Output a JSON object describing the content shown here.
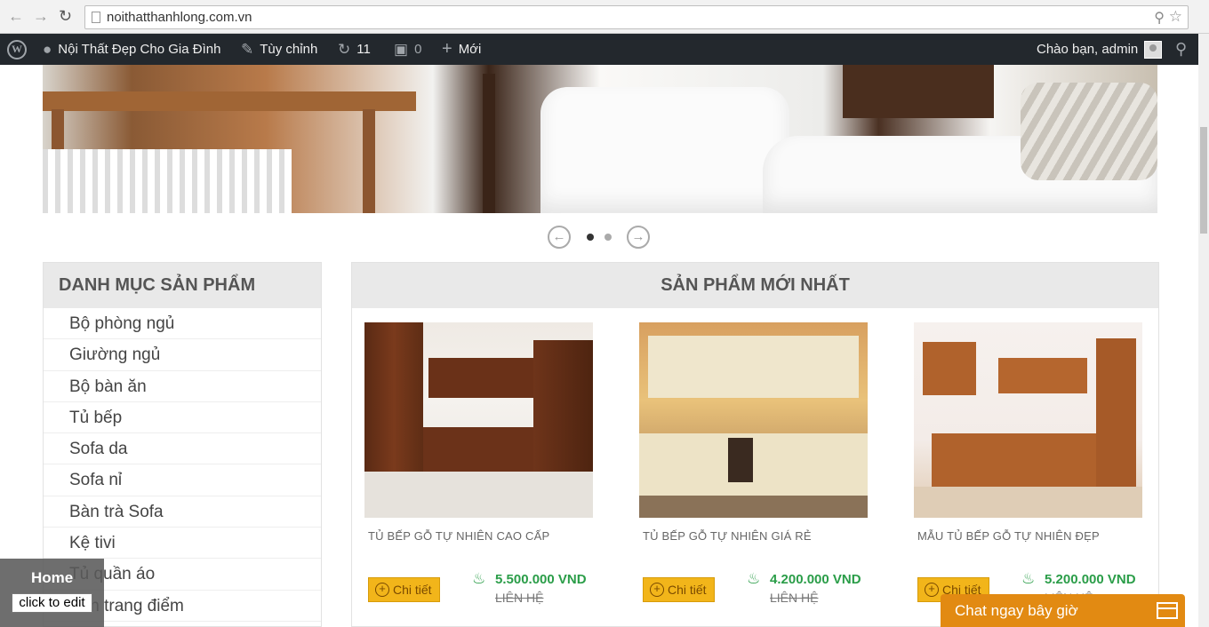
{
  "browser": {
    "url": "noithatthanhlong.com.vn"
  },
  "admin_bar": {
    "site_name": "Nội Thất Đẹp Cho Gia Đình",
    "customize": "Tùy chỉnh",
    "updates_count": "11",
    "comments_count": "0",
    "new_label": "Mới",
    "greeting": "Chào bạn, admin"
  },
  "sidebar": {
    "title": "DANH MỤC SẢN PHẨM",
    "items": [
      {
        "label": "Bộ phòng ngủ"
      },
      {
        "label": "Giường ngủ"
      },
      {
        "label": "Bộ bàn ăn"
      },
      {
        "label": "Tủ bếp"
      },
      {
        "label": "Sofa da"
      },
      {
        "label": "Sofa nỉ"
      },
      {
        "label": "Bàn trà Sofa"
      },
      {
        "label": "Kệ tivi"
      },
      {
        "label": "Tủ quần áo"
      },
      {
        "label": "Bàn trang điểm"
      }
    ]
  },
  "products": {
    "title": "SẢN PHẨM MỚI NHẤT",
    "detail_label": "Chi tiết",
    "items": [
      {
        "name": "TỦ BẾP GỖ TỰ NHIÊN CAO CẤP",
        "price": "5.500.000 VND",
        "old_price": "LIÊN HỆ"
      },
      {
        "name": "TỦ BẾP GỖ TỰ NHIÊN GIÁ RẺ",
        "price": "4.200.000 VND",
        "old_price": "LIÊN HỆ"
      },
      {
        "name": "MẪU TỦ BẾP GỖ TỰ NHIÊN ĐẸP",
        "price": "5.200.000 VND",
        "old_price": "LIÊN HỆ"
      }
    ]
  },
  "editor": {
    "home": "Home",
    "edit": "click to edit"
  },
  "chat": {
    "label": "Chat ngay bây giờ"
  },
  "colors": {
    "admin_bar": "#23282d",
    "accent_button": "#f2b51a",
    "price_green": "#2a9d48",
    "chat_orange": "#e28a12"
  }
}
